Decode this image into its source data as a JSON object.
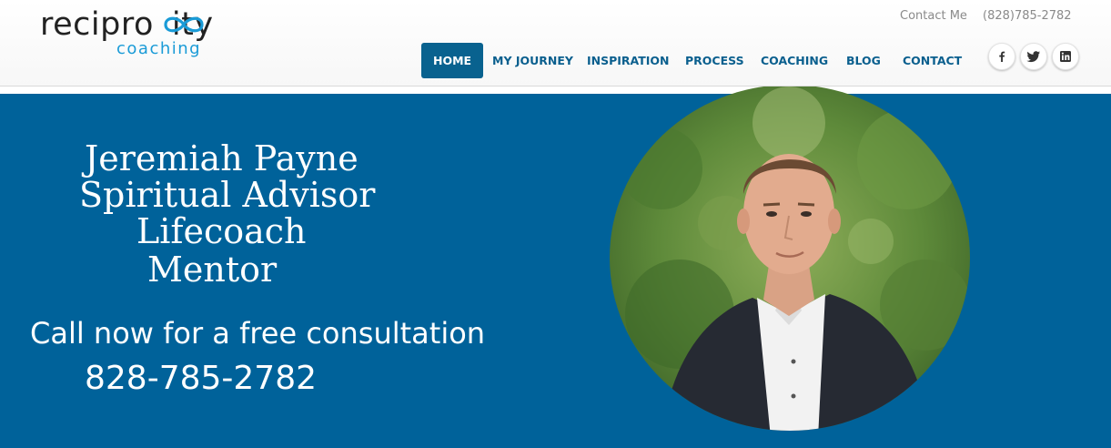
{
  "logo": {
    "main_text": "recipro",
    "main_tail": "ity",
    "sub_text": "coaching",
    "accent": "#1a9bd7"
  },
  "top_bar": {
    "contact_label": "Contact Me",
    "phone": "(828)785-2782"
  },
  "nav": {
    "items": [
      "HOME",
      "MY JOURNEY",
      "INSPIRATION",
      "PROCESS",
      "COACHING",
      "BLOG",
      "CONTACT"
    ],
    "active": "HOME",
    "active_color": "#09628f",
    "link_color": "#0a5f8e"
  },
  "social": [
    {
      "icon": "facebook-icon",
      "glyph": "f"
    },
    {
      "icon": "twitter-icon",
      "glyph": "bird"
    },
    {
      "icon": "linkedin-icon",
      "glyph": "in"
    }
  ],
  "hero": {
    "background": "#00629a",
    "lines": [
      "Jeremiah Payne",
      "Spiritual Advisor",
      "Lifecoach",
      "Mentor"
    ],
    "cta": "Call now for a free consultation",
    "cta_phone": "828-785-2782",
    "portrait": "circular-portrait-photo"
  }
}
